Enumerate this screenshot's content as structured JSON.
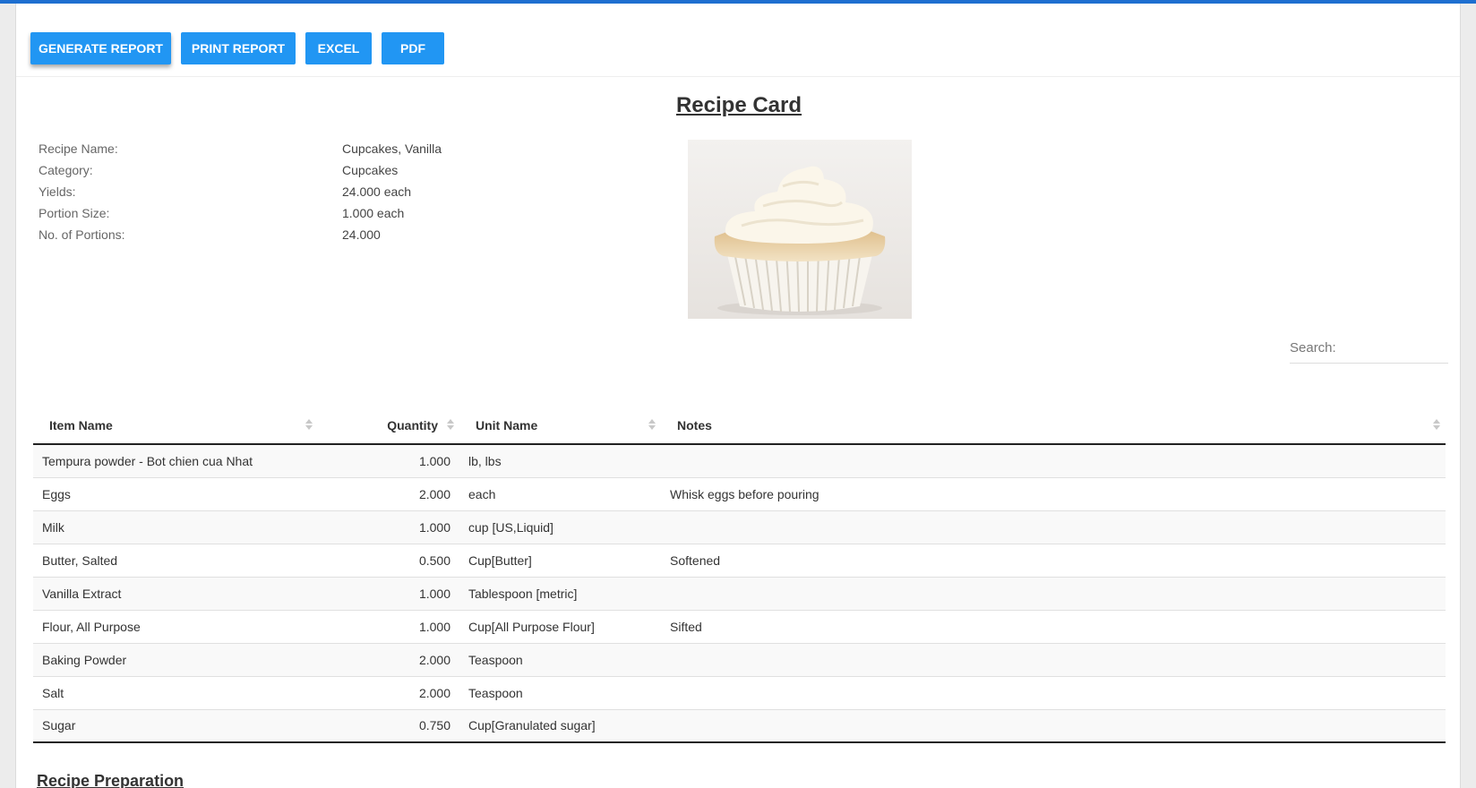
{
  "toolbar": {
    "generate": "GENERATE REPORT",
    "print": "PRINT REPORT",
    "excel": "EXCEL",
    "pdf": "PDF"
  },
  "card": {
    "title": "Recipe Card",
    "fields": [
      {
        "label": "Recipe Name:",
        "value": "Cupcakes, Vanilla"
      },
      {
        "label": "Category:",
        "value": "Cupcakes"
      },
      {
        "label": "Yields:",
        "value": "24.000 each"
      },
      {
        "label": "Portion Size:",
        "value": "1.000 each"
      },
      {
        "label": "No. of Portions:",
        "value": "24.000"
      }
    ],
    "photo_icon": "vanilla-cupcake-photo"
  },
  "search": {
    "label": "Search:",
    "value": ""
  },
  "table": {
    "columns": [
      "Item Name",
      "Quantity",
      "Unit Name",
      "Notes"
    ],
    "rows": [
      [
        "Tempura powder - Bot chien cua Nhat",
        "1.000",
        "lb, lbs",
        ""
      ],
      [
        "Eggs",
        "2.000",
        "each",
        "Whisk eggs before pouring"
      ],
      [
        "Milk",
        "1.000",
        "cup [US,Liquid]",
        ""
      ],
      [
        "Butter, Salted",
        "0.500",
        "Cup[Butter]",
        "Softened"
      ],
      [
        "Vanilla Extract",
        "1.000",
        "Tablespoon [metric]",
        ""
      ],
      [
        "Flour, All Purpose",
        "1.000",
        "Cup[All Purpose Flour]",
        "Sifted"
      ],
      [
        "Baking Powder",
        "2.000",
        "Teaspoon",
        ""
      ],
      [
        "Salt",
        "2.000",
        "Teaspoon",
        ""
      ],
      [
        "Sugar",
        "0.750",
        "Cup[Granulated sugar]",
        ""
      ]
    ]
  },
  "preparation": {
    "title": "Recipe Preparation"
  },
  "colors": {
    "accent": "#2196f3",
    "topbar": "#1e6fd0"
  }
}
